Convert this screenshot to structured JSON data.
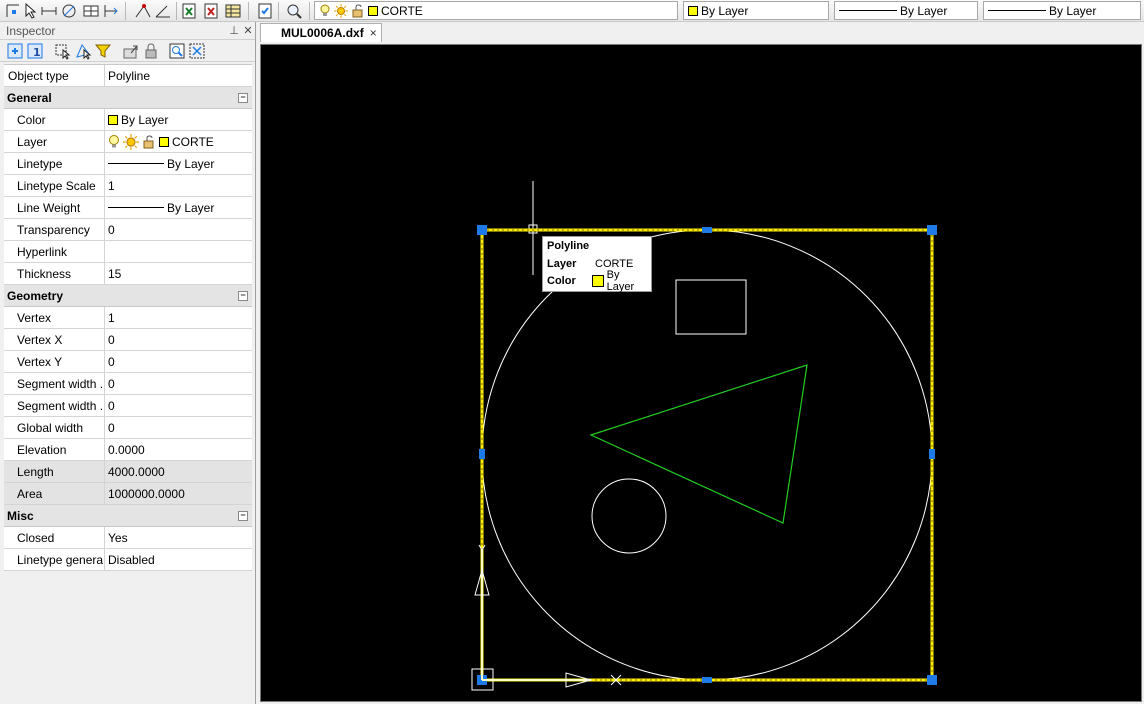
{
  "toolbar": {
    "layer_combo": "CORTE",
    "color_combo": "By Layer",
    "linetype_combo": "By Layer",
    "lineweight_combo": "By Layer"
  },
  "inspector": {
    "title": "Inspector",
    "object_type_label": "Object type",
    "object_type_value": "Polyline",
    "sections": {
      "general": "General",
      "geometry": "Geometry",
      "misc": "Misc"
    },
    "general": {
      "color_label": "Color",
      "color_value": "By Layer",
      "layer_label": "Layer",
      "layer_value": "CORTE",
      "linetype_label": "Linetype",
      "linetype_value": "By Layer",
      "linetype_scale_label": "Linetype Scale",
      "linetype_scale_value": "1",
      "line_weight_label": "Line Weight",
      "line_weight_value": "By Layer",
      "transparency_label": "Transparency",
      "transparency_value": "0",
      "hyperlink_label": "Hyperlink",
      "hyperlink_value": "",
      "thickness_label": "Thickness",
      "thickness_value": "15"
    },
    "geometry": {
      "vertex_label": "Vertex",
      "vertex_value": "1",
      "vertex_x_label": "Vertex X",
      "vertex_x_value": "0",
      "vertex_y_label": "Vertex Y",
      "vertex_y_value": "0",
      "segment_width_start_label": "Segment width ...",
      "segment_width_start_value": "0",
      "segment_width_end_label": "Segment width ...",
      "segment_width_end_value": "0",
      "global_width_label": "Global width",
      "global_width_value": "0",
      "elevation_label": "Elevation",
      "elevation_value": "0.0000",
      "length_label": "Length",
      "length_value": "4000.0000",
      "area_label": "Area",
      "area_value": "1000000.0000"
    },
    "misc": {
      "closed_label": "Closed",
      "closed_value": "Yes",
      "linetype_generation_label": "Linetype genera...",
      "linetype_generation_value": "Disabled"
    }
  },
  "document": {
    "tab_title": "MUL0006A.dxf",
    "close_glyph": "×"
  },
  "tooltip": {
    "title": "Polyline",
    "layer_label": "Layer",
    "layer_value": "CORTE",
    "color_label": "Color",
    "color_value": "By Layer"
  },
  "colors": {
    "layer_yellow": "#ffff00",
    "selection_yellow": "#ffee00",
    "grip_blue": "#1e7ae6",
    "triangle_green": "#22cc22",
    "canvas_bg": "#000000"
  },
  "icons": [
    "snap-icon",
    "measure-icon",
    "layer-bulb-icon",
    "layer-sun-icon",
    "layer-lock-icon",
    "pin-icon",
    "close-icon",
    "collapse-icon",
    "select-icon",
    "filter-icon"
  ]
}
